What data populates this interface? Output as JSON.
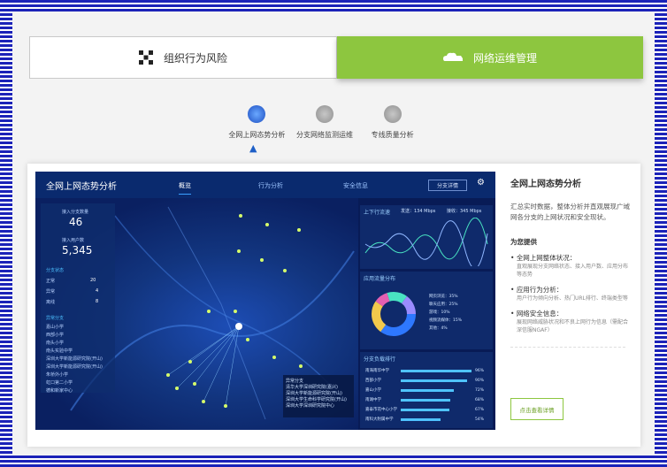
{
  "tabs": {
    "risk_label": "组织行为风险",
    "ops_label": "网络运维管理"
  },
  "sub_tabs": [
    {
      "label": "全网上网态势分析"
    },
    {
      "label": "分支网络监测运维"
    },
    {
      "label": "专线质量分析"
    }
  ],
  "dashboard": {
    "title": "全网上网态势分析",
    "nav": [
      "概览",
      "行为分析",
      "安全信息"
    ],
    "detail_button": "分支详情",
    "branches_label": "接入分支数量",
    "branches_value": "46",
    "users_label": "接入用户数",
    "users_value": "5,345",
    "status_title": "分支状态",
    "status": [
      {
        "label": "正常",
        "value": "20"
      },
      {
        "label": "异常",
        "value": "4"
      },
      {
        "label": "离线",
        "value": "8"
      }
    ],
    "abnormal_title": "异常分支",
    "abnormal": [
      "嘉山小学",
      "西部小学",
      "南头小学",
      "南头实验中学",
      "深圳大学新能源研究院(开山)",
      "深圳大学新能源研究院(开山)",
      "朱桥外小学",
      "虹口第二小学",
      "德和新家中心"
    ],
    "traffic_title": "上下行流速",
    "up_label": "发送：134 Mbps",
    "down_label": "接收：345 Mbps",
    "app_title": "应用流量分布",
    "apps": [
      "网页浏览：35%",
      "聊天应用：25%",
      "游戏：10%",
      "视频流媒体：15%",
      "其他：4%"
    ],
    "load_title": "分支负载排行",
    "loads": [
      {
        "name": "南海南华中学",
        "pct": "96%"
      },
      {
        "name": "西部小学",
        "pct": "90%"
      },
      {
        "name": "嘉山小学",
        "pct": "72%"
      },
      {
        "name": "南湖中学",
        "pct": "68%"
      },
      {
        "name": "嘉泰市花中心小学",
        "pct": "67%"
      },
      {
        "name": "南科大附属中学",
        "pct": "54%"
      }
    ],
    "legend_title": "异常分支",
    "legend": [
      "清华大学深圳研究院(嘉兴)",
      "深圳大学新能源研究院(开山)",
      "深圳大学生命科学研究院(开山)",
      "深圳大学深圳研究院中心"
    ]
  },
  "desc": {
    "title": "全网上网态势分析",
    "intro": "汇总实时数据，整体分析并直观展现广域网各分支的上网状况和安全现状。",
    "provides": "为您提供",
    "items": [
      {
        "title": "全网上网整体状况：",
        "sub": "直观展现分支网络状态、接入用户数、应用分布等态势"
      },
      {
        "title": "应用行为分析：",
        "sub": "用户行为倾向分析、热门URL排行、终端类型等"
      },
      {
        "title": "网络安全信息：",
        "sub": "展现网络威胁状况和不良上网行为信息（需配合深信服NGAF）"
      }
    ],
    "cta": "点击查看详情"
  },
  "colors": {
    "accent": "#8dc63f",
    "dash_bg": "#081b56",
    "stripe": "#1b22b8"
  }
}
